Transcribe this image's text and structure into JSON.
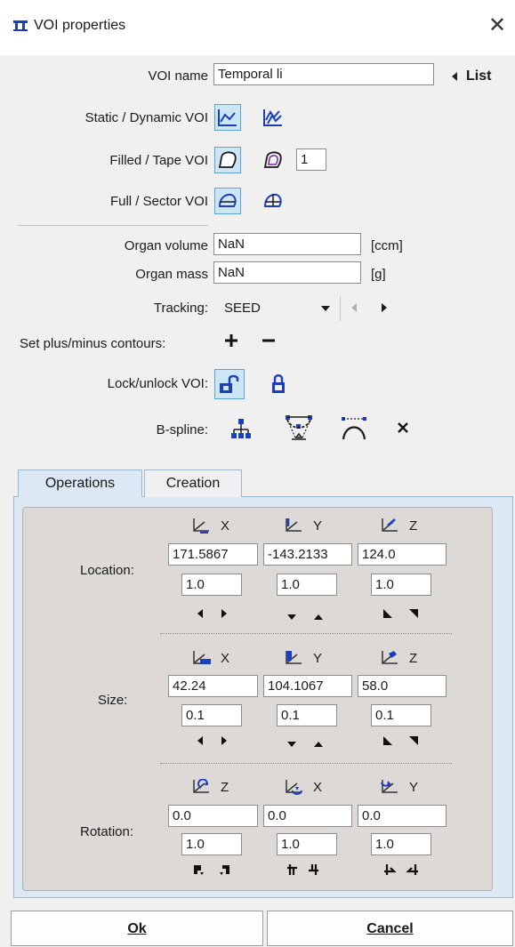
{
  "window": {
    "title": "VOI properties",
    "close_glyph": "✕"
  },
  "voi_name": {
    "label": "VOI name",
    "value": "Temporal li",
    "list_button": "List"
  },
  "rows": {
    "static_dynamic": "Static / Dynamic VOI",
    "filled_tape": "Filled / Tape VOI",
    "tape_width": "1",
    "full_sector": "Full / Sector VOI",
    "organ_volume": {
      "label": "Organ volume",
      "value": "NaN",
      "unit": "[ccm]"
    },
    "organ_mass": {
      "label": "Organ mass",
      "value": "NaN",
      "unit": "[g]"
    },
    "tracking": {
      "label": "Tracking:",
      "value": "SEED"
    },
    "plus_minus": "Set plus/minus contours:",
    "lock": "Lock/unlock VOI:",
    "bspline": "B-spline:"
  },
  "tabs": [
    {
      "label": "Operations"
    },
    {
      "label": "Creation"
    }
  ],
  "location": {
    "label": "Location:",
    "axes": [
      "X",
      "Y",
      "Z"
    ],
    "values": [
      "171.5867",
      "-143.2133",
      "124.0"
    ],
    "steps": [
      "1.0",
      "1.0",
      "1.0"
    ]
  },
  "size": {
    "label": "Size:",
    "axes": [
      "X",
      "Y",
      "Z"
    ],
    "values": [
      "42.24",
      "104.1067",
      "58.0"
    ],
    "steps": [
      "0.1",
      "0.1",
      "0.1"
    ]
  },
  "rotation": {
    "label": "Rotation:",
    "axes": [
      "Z",
      "X",
      "Y"
    ],
    "values": [
      "0.0",
      "0.0",
      "0.0"
    ],
    "steps": [
      "1.0",
      "1.0",
      "1.0"
    ]
  },
  "buttons": {
    "ok": "Ok",
    "cancel": "Cancel"
  },
  "colors": {
    "accent_blue": "#1c3fbf",
    "selection_bg": "#cce6f6",
    "tab_panel": "#dce9f5",
    "inner_panel": "#ddd9d6"
  }
}
